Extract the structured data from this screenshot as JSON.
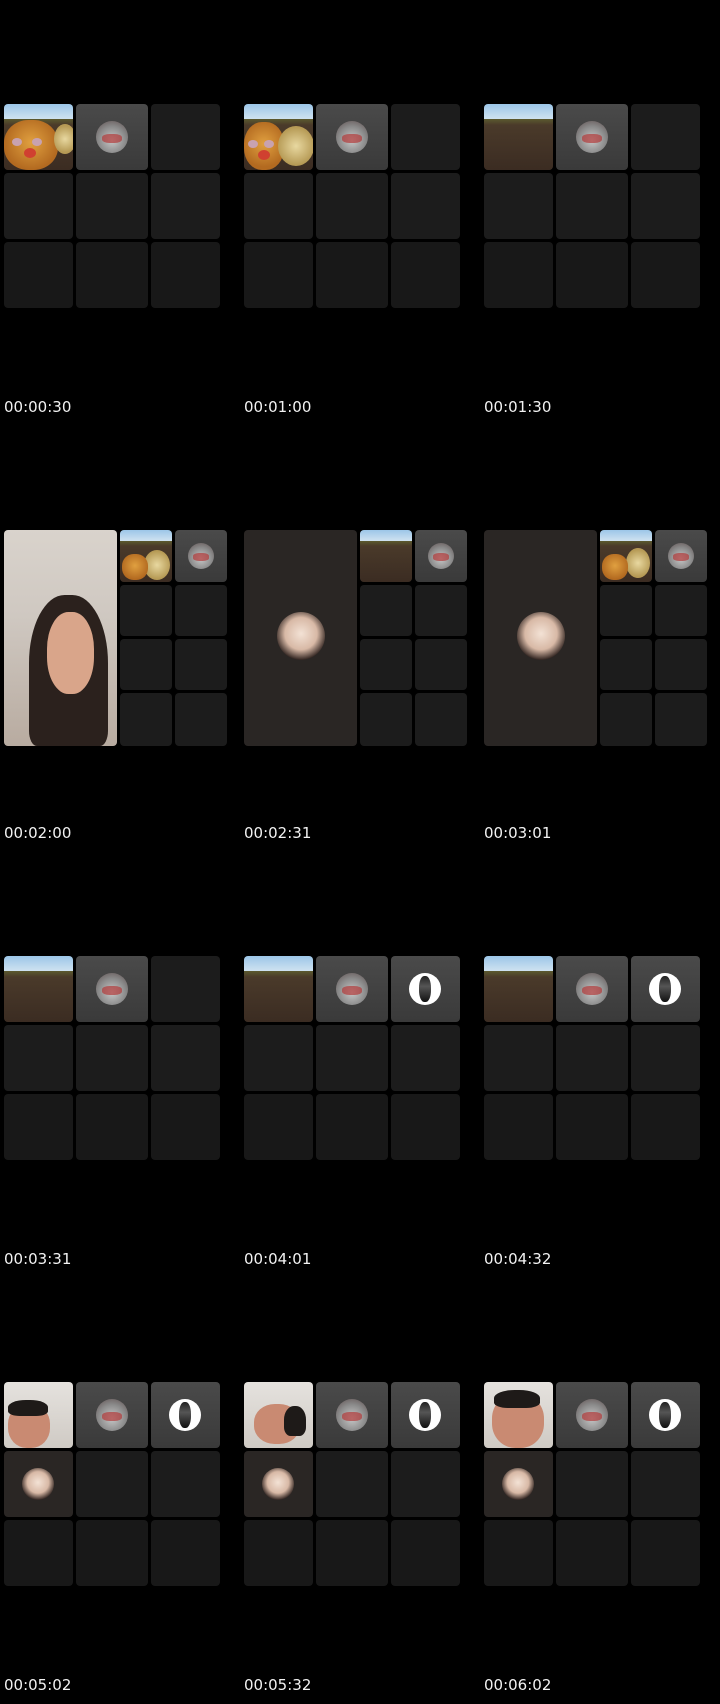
{
  "frames": [
    {
      "timestamp": "00:00:30"
    },
    {
      "timestamp": "00:01:00"
    },
    {
      "timestamp": "00:01:30"
    },
    {
      "timestamp": "00:02:00"
    },
    {
      "timestamp": "00:02:31"
    },
    {
      "timestamp": "00:03:01"
    },
    {
      "timestamp": "00:03:31"
    },
    {
      "timestamp": "00:04:01"
    },
    {
      "timestamp": "00:04:32"
    },
    {
      "timestamp": "00:05:02"
    },
    {
      "timestamp": "00:05:32"
    },
    {
      "timestamp": "00:06:02"
    }
  ],
  "icons": {
    "participant_avatar": "avatar-icon",
    "effect_video": "video-feed"
  },
  "colors": {
    "background": "#000000",
    "tile": "#1c1c1c",
    "text": "#f2f2f2"
  }
}
